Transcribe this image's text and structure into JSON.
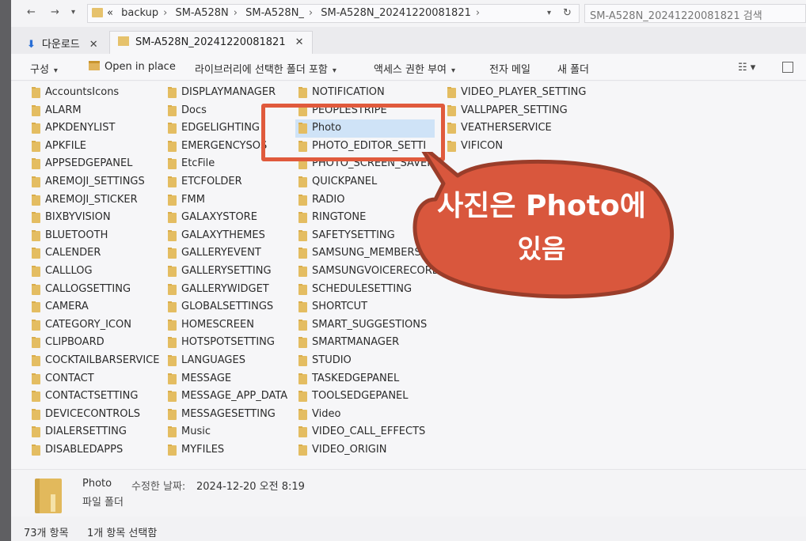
{
  "address_bar": {
    "crumbs": [
      "backup",
      "SM-A528N",
      "SM-A528N_",
      "SM-A528N_20241220081821"
    ],
    "overflow": "«",
    "search_placeholder": "SM-A528N_20241220081821 검색"
  },
  "tabs": [
    {
      "label": "다운로드",
      "icon": "download-arrow-icon"
    },
    {
      "label": "SM-A528N_20241220081821",
      "icon": "folder-icon"
    }
  ],
  "command_bar": {
    "organize": "구성",
    "open_in_place": "Open in place",
    "include_library": "라이브러리에 선택한 폴더 포함",
    "share_access": "액세스 권한 부여",
    "email": "전자 메일",
    "new_folder": "새 폴더"
  },
  "columns": [
    [
      "AccountsIcons",
      "ALARM",
      "APKDENYLIST",
      "APKFILE",
      "APPSEDGEPANEL",
      "AREMOJI_SETTINGS",
      "AREMOJI_STICKER",
      "BIXBYVISION",
      "BLUETOOTH",
      "CALENDER",
      "CALLLOG",
      "CALLOGSETTING",
      "CAMERA",
      "CATEGORY_ICON",
      "CLIPBOARD",
      "COCKTAILBARSERVICE",
      "CONTACT",
      "CONTACTSETTING",
      "DEVICECONTROLS",
      "DIALERSETTING",
      "DISABLEDAPPS"
    ],
    [
      "DISPLAYMANAGER",
      "Docs",
      "EDGELIGHTING",
      "EMERGENCYSOS",
      "EtcFile",
      "ETCFOLDER",
      "FMM",
      "GALAXYSTORE",
      "GALAXYTHEMES",
      "GALLERYEVENT",
      "GALLERYSETTING",
      "GALLERYWIDGET",
      "GLOBALSETTINGS",
      "HOMESCREEN",
      "HOTSPOTSETTING",
      "LANGUAGES",
      "MESSAGE",
      "MESSAGE_APP_DATA",
      "MESSAGESETTING",
      "Music",
      "MYFILES"
    ],
    [
      "NOTIFICATION",
      "PEOPLESTRIPE",
      "Photo",
      "PHOTO_EDITOR_SETTI",
      "PHOTO_SCREEN_SAVER",
      "QUICKPANEL",
      "RADIO",
      "RINGTONE",
      "SAFETYSETTING",
      "SAMSUNG_MEMBERS",
      "SAMSUNGVOICERECORD",
      "SCHEDULESETTING",
      "SHORTCUT",
      "SMART_SUGGESTIONS",
      "SMARTMANAGER",
      "STUDIO",
      "TASKEDGEPANEL",
      "TOOLSEDGEPANEL",
      "Video",
      "VIDEO_CALL_EFFECTS",
      "VIDEO_ORIGIN"
    ],
    [
      "VIDEO_PLAYER_SETTING",
      "VALLPAPER_SETTING",
      "VEATHERSERVICE",
      "VIFICON"
    ]
  ],
  "selected_item": "Photo",
  "callout": {
    "line1": "사진은 Photo에",
    "line2": "있음",
    "color": "#d9573d",
    "border_color": "#9a3d2a"
  },
  "highlight_color": "#e05a3c",
  "details": {
    "name": "Photo",
    "modified_label": "수정한 날짜:",
    "modified_value": "2024-12-20 오전 8:19",
    "type": "파일 폴더"
  },
  "status": {
    "item_count": "73개 항목",
    "selected_count": "1개 항목 선택함"
  }
}
